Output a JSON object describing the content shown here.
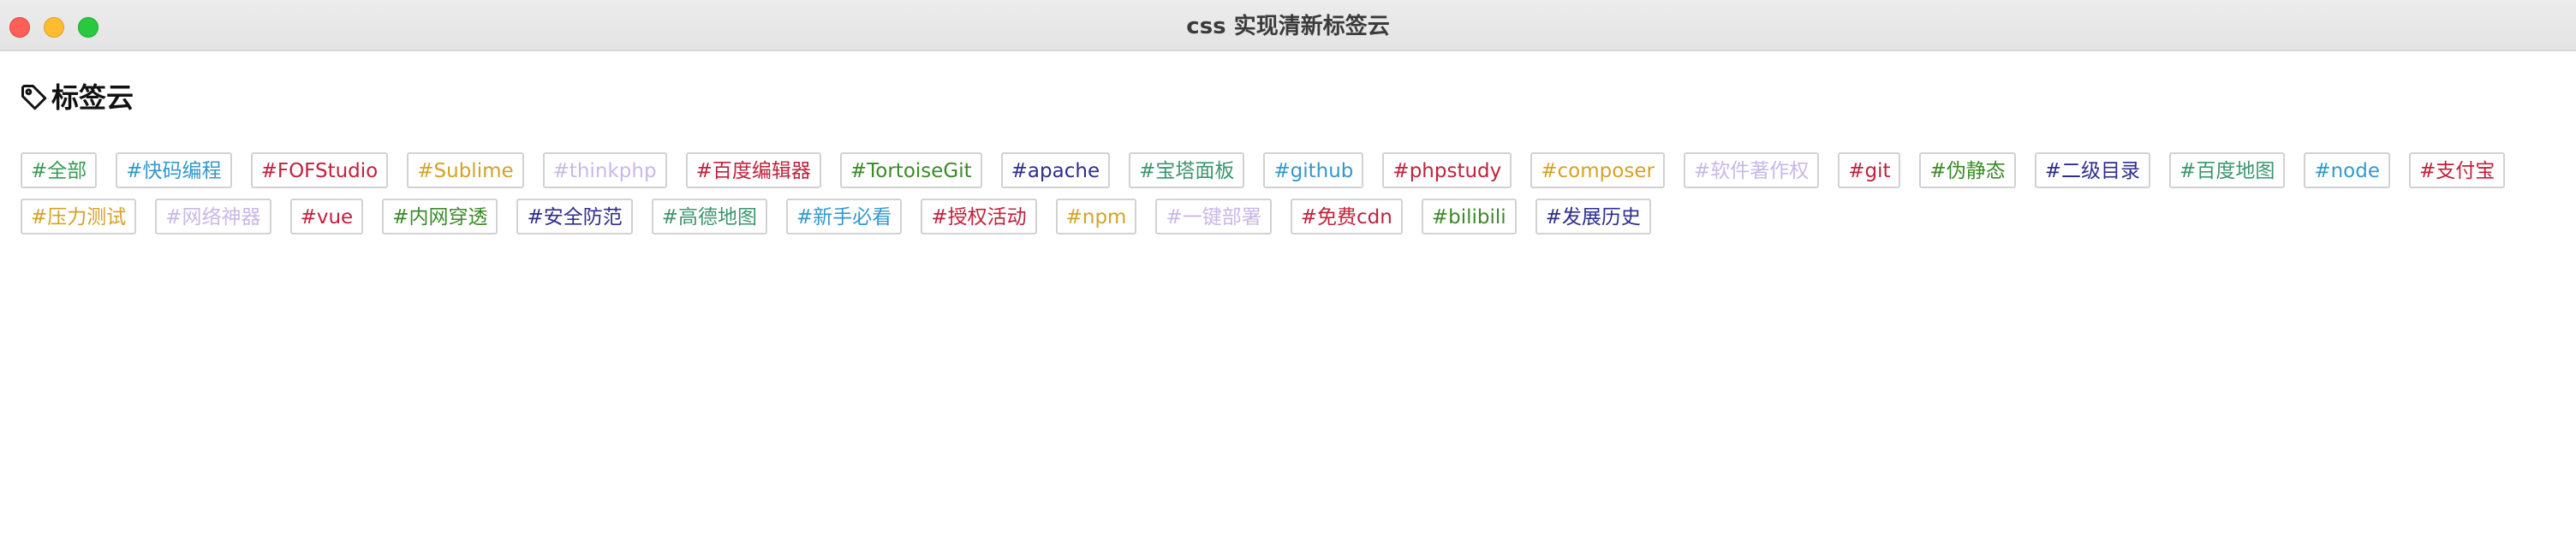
{
  "window": {
    "title": "css 实现清新标签云"
  },
  "heading": {
    "icon": "tag-icon",
    "text": "标签云"
  },
  "colors": {
    "green": "#4e9e52",
    "blue": "#3399cc",
    "red": "#c0223c",
    "orange": "#d4a22a",
    "lavender": "#c9b8e8",
    "darkblue": "#2e2e8e",
    "teal": "#3c9670",
    "darkgreen": "#3b8a28"
  },
  "tags": [
    {
      "label": "#全部",
      "color": "#3a9b55"
    },
    {
      "label": "#快码编程",
      "color": "#3399cc"
    },
    {
      "label": "#FOFStudio",
      "color": "#c0223c"
    },
    {
      "label": "#Sublime",
      "color": "#d4a22a"
    },
    {
      "label": "#thinkphp",
      "color": "#c9b8e8"
    },
    {
      "label": "#百度编辑器",
      "color": "#c0223c"
    },
    {
      "label": "#TortoiseGit",
      "color": "#3b8a28"
    },
    {
      "label": "#apache",
      "color": "#2e2e8e"
    },
    {
      "label": "#宝塔面板",
      "color": "#3c9670"
    },
    {
      "label": "#github",
      "color": "#3399cc"
    },
    {
      "label": "#phpstudy",
      "color": "#c0223c"
    },
    {
      "label": "#composer",
      "color": "#d4a22a"
    },
    {
      "label": "#软件著作权",
      "color": "#c9b8e8"
    },
    {
      "label": "#git",
      "color": "#c0223c"
    },
    {
      "label": "#伪静态",
      "color": "#3b8a28"
    },
    {
      "label": "#二级目录",
      "color": "#2e2e8e"
    },
    {
      "label": "#百度地图",
      "color": "#3c9670"
    },
    {
      "label": "#node",
      "color": "#3399cc"
    },
    {
      "label": "#支付宝",
      "color": "#c0223c"
    },
    {
      "label": "#压力测试",
      "color": "#d4a22a"
    },
    {
      "label": "#网络神器",
      "color": "#c9b8e8"
    },
    {
      "label": "#vue",
      "color": "#c0223c"
    },
    {
      "label": "#内网穿透",
      "color": "#3b8a28"
    },
    {
      "label": "#安全防范",
      "color": "#2e2e8e"
    },
    {
      "label": "#高德地图",
      "color": "#3c9670"
    },
    {
      "label": "#新手必看",
      "color": "#3399cc"
    },
    {
      "label": "#授权活动",
      "color": "#c0223c"
    },
    {
      "label": "#npm",
      "color": "#d4a22a"
    },
    {
      "label": "#一键部署",
      "color": "#c9b8e8"
    },
    {
      "label": "#免费cdn",
      "color": "#c0223c"
    },
    {
      "label": "#bilibili",
      "color": "#3b8a28"
    },
    {
      "label": "#发展历史",
      "color": "#2e2e8e"
    }
  ]
}
